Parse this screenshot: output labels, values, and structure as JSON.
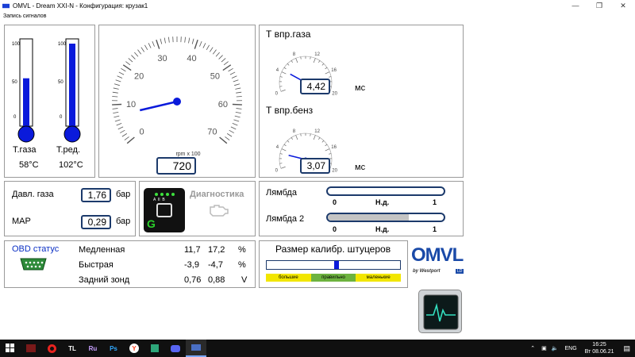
{
  "window": {
    "title": "OMVL - Dream XXI-N - Конфигурация: крузак1",
    "menu_record": "Запись сигналов"
  },
  "thermometers": [
    {
      "label": "Т.газа",
      "value": "58°C",
      "fill_percent": 58,
      "ticks": [
        "100",
        "50",
        "0"
      ]
    },
    {
      "label": "Т.ред.",
      "value": "102°C",
      "fill_percent": 100,
      "ticks": [
        "100",
        "50",
        "0"
      ]
    }
  ],
  "rpm_gauge": {
    "ticks": [
      "0",
      "10",
      "20",
      "30",
      "40",
      "50",
      "60",
      "70"
    ],
    "unit": "rpm x 100",
    "value": "720",
    "needle_value": 7.2,
    "max": 70
  },
  "injection": {
    "gas": {
      "title": "Т впр.газа",
      "value": "4,42",
      "unit": "мс",
      "ticks": [
        "0",
        "4",
        "8",
        "12",
        "16",
        "20"
      ],
      "needle_value": 4.42
    },
    "petrol": {
      "title": "Т впр.бенз",
      "value": "3,07",
      "unit": "мс",
      "ticks": [
        "0",
        "4",
        "8",
        "12",
        "16",
        "20"
      ],
      "needle_value": 3.07
    }
  },
  "pressure": {
    "gas_label": "Давл. газа",
    "gas_value": "1,76",
    "gas_unit": "бар",
    "map_label": "MAP",
    "map_value": "0,29",
    "map_unit": "бар"
  },
  "diagnostics": {
    "switch_letters": "A  II  B",
    "switch_mode": "G",
    "label": "Диагностика"
  },
  "lambda": {
    "l1_label": "Лямбда",
    "l2_label": "Лямбда 2",
    "scale_min": "0",
    "scale_max": "1",
    "na": "Н.д.",
    "l1_fill": 0.0,
    "l2_fill": 0.7
  },
  "obd": {
    "title": "OBD статус",
    "rows": [
      {
        "name": "Медленная",
        "v1": "11,7",
        "v2": "17,2",
        "unit": "%"
      },
      {
        "name": "Быстрая",
        "v1": "-3,9",
        "v2": "-4,7",
        "unit": "%"
      },
      {
        "name": "Задний зонд",
        "v1": "0,76",
        "v2": "0,88",
        "unit": "V"
      }
    ]
  },
  "nozzle": {
    "title": "Размер калибр. штуцеров",
    "marker": 0.52,
    "zones": [
      {
        "label": "большие",
        "color": "#f2e600"
      },
      {
        "label": "правильно",
        "color": "#6db33f"
      },
      {
        "label": "маленькие",
        "color": "#f2e600"
      }
    ]
  },
  "brand": {
    "name": "OMVL",
    "sub": "by Westport",
    "badge": "LD"
  },
  "taskbar": {
    "apps": [
      "TL",
      "Ru",
      "Ps",
      "Y"
    ],
    "lang": "ENG",
    "time": "16:25",
    "date": "Вт 08.06.21"
  },
  "colors": {
    "accent": "#1a3fd6",
    "frame": "#1c3a6b"
  }
}
